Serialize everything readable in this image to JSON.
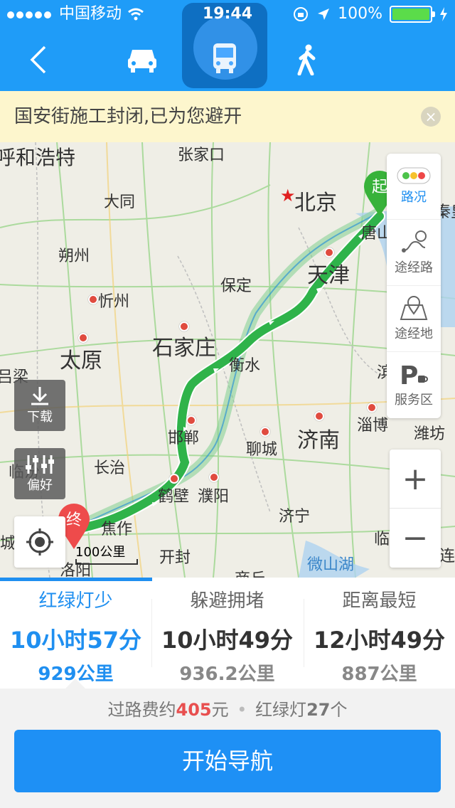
{
  "status": {
    "carrier": "中国移动",
    "time": "19:44",
    "battery": "100%",
    "battery_level": 1.0
  },
  "banner": {
    "text": "国安街施工封闭,已为您避开",
    "close": "×"
  },
  "map": {
    "cities_big": [
      {
        "name": "呼和浩特"
      },
      {
        "name": "北京"
      },
      {
        "name": "天津"
      },
      {
        "name": "石家庄"
      },
      {
        "name": "太原"
      },
      {
        "name": "济南"
      }
    ],
    "cities": [
      "张家口",
      "大同",
      "朔州",
      "忻州",
      "保定",
      "衡水",
      "邯郸",
      "长治",
      "鹤壁",
      "濮阳",
      "焦作",
      "开封",
      "聊城",
      "淄博",
      "潍坊",
      "济宁",
      "唐山",
      "滨",
      "吕梁",
      "临汾",
      "城",
      "秦皇",
      "连",
      "临",
      "商丘",
      "洛阳"
    ],
    "lake": "微山湖",
    "start_label": "起",
    "end_label": "终",
    "scale": "100公里",
    "toolbar": [
      {
        "name": "traffic",
        "label": "路况",
        "active": true
      },
      {
        "name": "waypoint-road",
        "label": "途经路",
        "active": false
      },
      {
        "name": "waypoint-place",
        "label": "途经地",
        "active": false
      },
      {
        "name": "service-area",
        "label": "服务区",
        "active": false
      }
    ],
    "download": "下载",
    "preference": "偏好",
    "zoom_in": "+",
    "zoom_out": "−"
  },
  "routes": [
    {
      "label": "红绿灯少",
      "time": "10小时57分",
      "distance": "929公里",
      "active": true
    },
    {
      "label": "躲避拥堵",
      "time": "10小时49分",
      "distance": "936.2公里",
      "active": false
    },
    {
      "label": "距离最短",
      "time": "12小时49分",
      "distance": "887公里",
      "active": false
    }
  ],
  "info": {
    "toll_prefix": "过路费约",
    "toll_amount": "405",
    "toll_unit": "元",
    "sep": "•",
    "lights_prefix": "红绿灯",
    "lights_count": "27",
    "lights_unit": "个"
  },
  "start_button": "开始导航",
  "colors": {
    "primary": "#1f9cf8",
    "route": "#2fb34a",
    "banner": "#fdf6cd"
  }
}
